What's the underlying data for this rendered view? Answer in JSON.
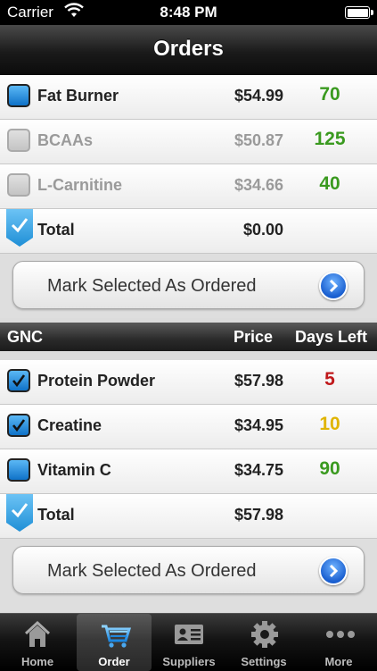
{
  "status_bar": {
    "carrier": "Carrier",
    "time": "8:48 PM"
  },
  "nav": {
    "title": "Orders"
  },
  "group1": {
    "items": [
      {
        "name": "Fat Burner",
        "price": "$54.99",
        "days": "70",
        "days_color": "#3a9a1f",
        "state": "unchecked"
      },
      {
        "name": "BCAAs",
        "price": "$50.87",
        "days": "125",
        "days_color": "#3a9a1f",
        "state": "disabled"
      },
      {
        "name": "L-Carnitine",
        "price": "$34.66",
        "days": "40",
        "days_color": "#3a9a1f",
        "state": "disabled"
      }
    ],
    "total_label": "Total",
    "total_value": "$0.00",
    "button_label": "Mark Selected As Ordered"
  },
  "group2": {
    "header": {
      "supplier": "GNC",
      "price": "Price",
      "days_left": "Days Left"
    },
    "items": [
      {
        "name": "Protein Powder",
        "price": "$57.98",
        "days": "5",
        "days_color": "#c0191b",
        "state": "checked"
      },
      {
        "name": "Creatine",
        "price": "$34.95",
        "days": "10",
        "days_color": "#e0b400",
        "state": "checked"
      },
      {
        "name": "Vitamin C",
        "price": "$34.75",
        "days": "90",
        "days_color": "#3a9a1f",
        "state": "unchecked"
      }
    ],
    "total_label": "Total",
    "total_value": "$57.98",
    "button_label": "Mark Selected As Ordered"
  },
  "tabs": [
    {
      "label": "Home",
      "icon": "home-icon"
    },
    {
      "label": "Order",
      "icon": "cart-icon",
      "active": true
    },
    {
      "label": "Suppliers",
      "icon": "contact-card-icon"
    },
    {
      "label": "Settings",
      "icon": "gear-icon"
    },
    {
      "label": "More",
      "icon": "more-icon"
    }
  ]
}
